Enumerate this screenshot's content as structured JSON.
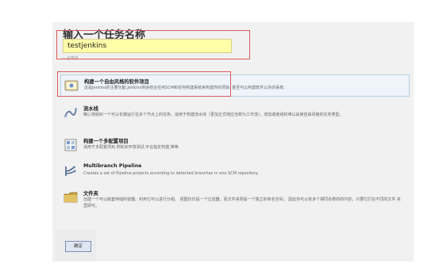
{
  "form": {
    "title": "输入一个任务名称",
    "name_value": "testjenkins",
    "required_hint": "» 必填项"
  },
  "jobs": [
    {
      "name": "构建一个自由风格的软件项目",
      "description": "这是Jenkins的主要功能.Jenkins将会结合任何SCM和任何构建系统来构建你的项目, 甚至可以构建软件以外的系统.",
      "icon": "freestyle-project-icon"
    },
    {
      "name": "流水线",
      "description": "精心地组织一个可以长期运行在多个节点上的任务。适用于构建流水线（更加正式地应当称为工作流），增加或者组织难以采用自由风格的任务类型。",
      "icon": "pipeline-icon"
    },
    {
      "name": "构建一个多配置项目",
      "description": "适用于多配置项目,例如多环境测试,平台指定构建,等等.",
      "icon": "multi-configuration-icon"
    },
    {
      "name": "Multibranch Pipeline",
      "description": "Creates a set of Pipeline projects according to detected branches in one SCM repository.",
      "icon": "multibranch-pipeline-icon"
    },
    {
      "name": "文件夹",
      "description": "创建一个可以嵌套存储的容器。利用它可以进行分组。 视图仅仅是一个过滤器，而文件夹则是一个独立的命名空间， 因此你可以有多个相同名称的的内容，只要它们在不同的文件 夹里即可。",
      "icon": "folder-icon"
    }
  ],
  "actions": {
    "ok_label": "确定"
  }
}
